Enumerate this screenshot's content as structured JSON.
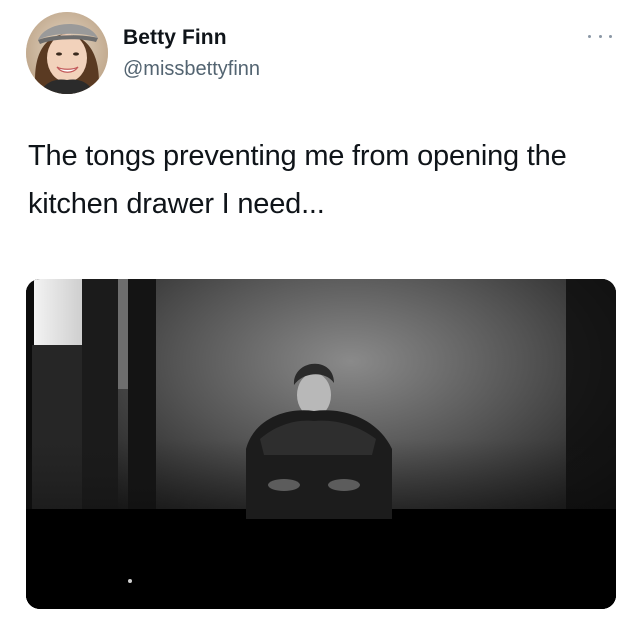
{
  "tweet": {
    "author": {
      "display_name": "Betty Finn",
      "handle": "@missbettyfinn",
      "avatar_icon": "avatar-photo"
    },
    "more_icon": "more-horizontal-icon",
    "text": "The tongs preventing me from opening the kitchen drawer I need...",
    "media": {
      "kind": "photo",
      "tone": "black-and-white",
      "subject": "man-crouching-in-dark-room"
    }
  },
  "colors": {
    "text": "#0f1419",
    "secondary_text": "#536471",
    "background": "#ffffff"
  }
}
